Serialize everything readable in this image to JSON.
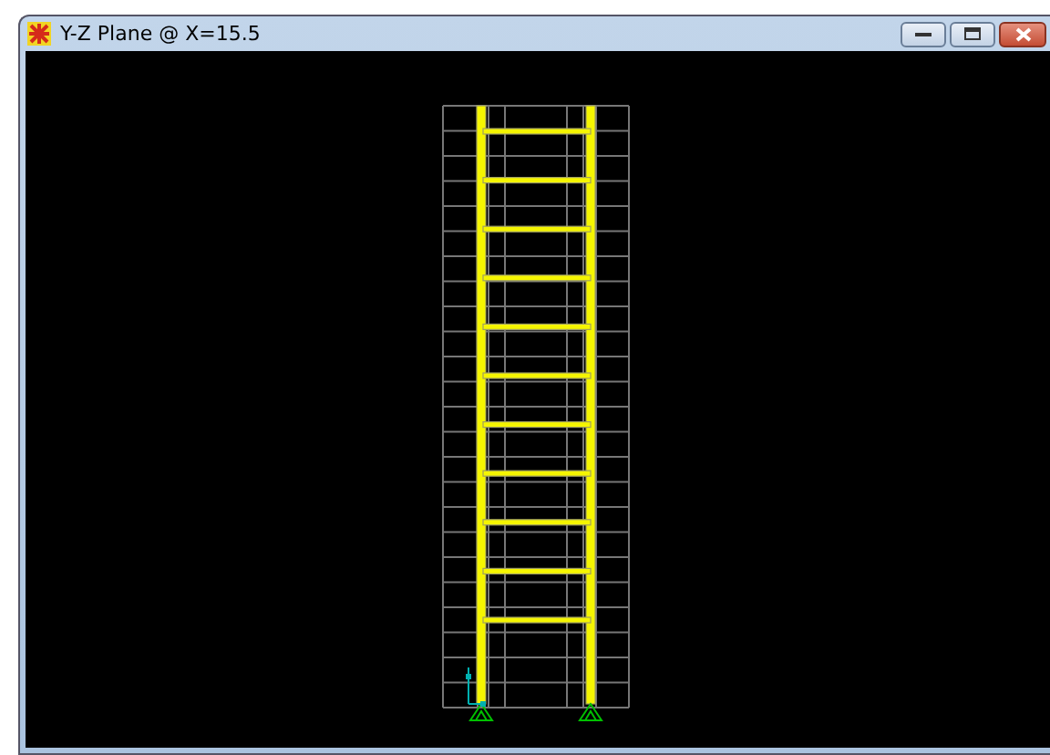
{
  "window": {
    "title": "Y-Z Plane @ X=15.5"
  }
}
